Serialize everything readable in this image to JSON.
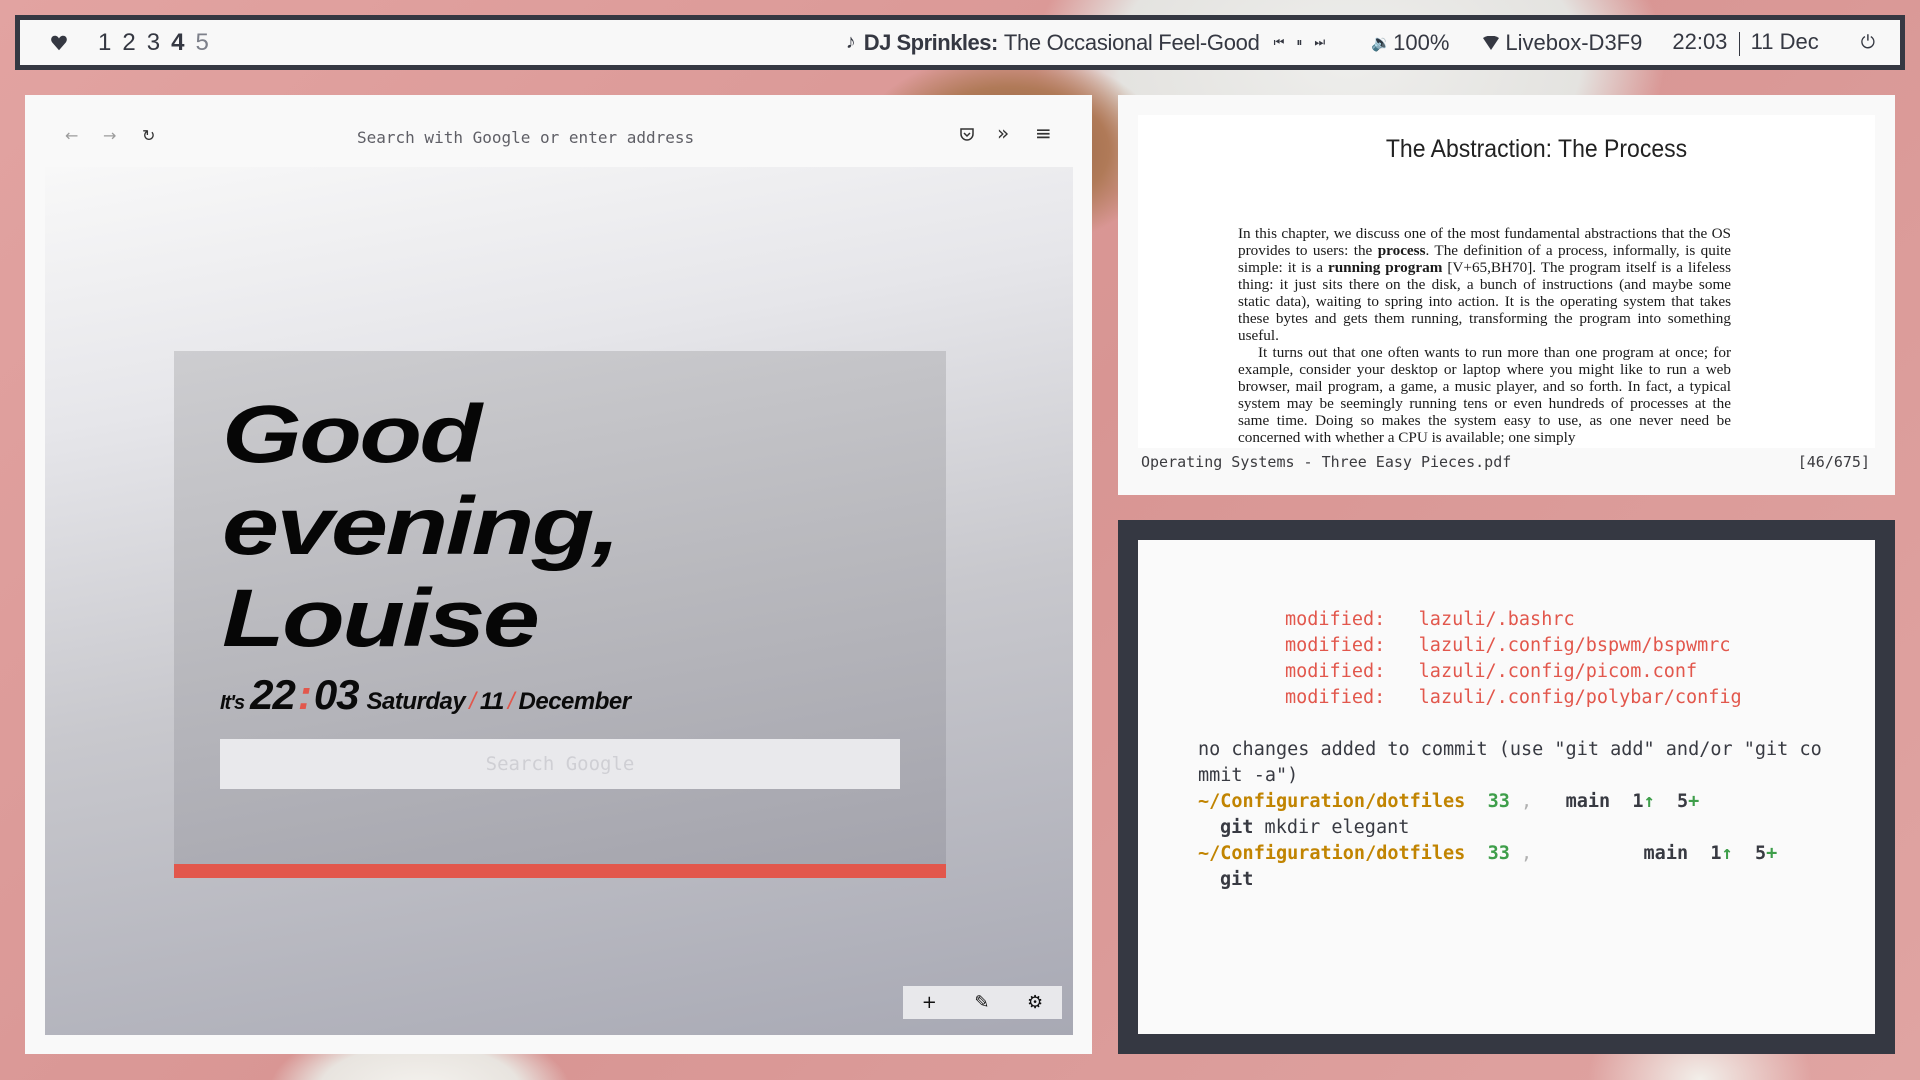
{
  "topbar": {
    "heart_icon": "heart-icon",
    "workspaces": [
      {
        "label": "1",
        "state": "normal"
      },
      {
        "label": "2",
        "state": "normal"
      },
      {
        "label": "3",
        "state": "normal"
      },
      {
        "label": "4",
        "state": "active"
      },
      {
        "label": "5",
        "state": "empty"
      }
    ],
    "music": {
      "icon": "music-note-icon",
      "artist": "DJ Sprinkles:",
      "track": "The Occasional Feel-Good",
      "controls": [
        "prev-icon",
        "pause-icon",
        "next-icon"
      ]
    },
    "volume": {
      "icon": "speaker-icon",
      "value": "100%"
    },
    "network": {
      "icon": "wifi-icon",
      "ssid": "Livebox-D3F9"
    },
    "clock": {
      "time": "22:03",
      "date": "11 Dec"
    },
    "power_icon": "power-icon"
  },
  "browser": {
    "toolbar": {
      "back_icon": "←",
      "forward_icon": "→",
      "reload_icon": "↻",
      "url_placeholder": "Search with Google or enter address",
      "pocket_icon": "pocket-icon",
      "overflow_icon": "»",
      "menu_icon": "≡"
    },
    "startpage": {
      "greeting_lines": [
        "Good",
        "evening,",
        "Louise"
      ],
      "its": "It's",
      "hour": "22",
      "colon": ":",
      "minute": "03",
      "weekday": "Saturday",
      "slash": "/",
      "day": "11",
      "month": "December",
      "search_placeholder": "Search Google",
      "accent_color": "#e2574c"
    },
    "dock": {
      "add": "+",
      "edit": "✎",
      "settings": "⚙"
    }
  },
  "pdf": {
    "title": "The Abstraction: The Process",
    "paragraph1": [
      {
        "t": "In this chapter, we discuss one of the most fundamental abstractions that the OS provides to users: the ",
        "b": false
      },
      {
        "t": "process",
        "b": true
      },
      {
        "t": ". The definition of a process, informally, is quite simple: it is a ",
        "b": false
      },
      {
        "t": "running program",
        "b": true
      },
      {
        "t": " [V+65,BH70]. The program itself is a lifeless thing: it just sits there on the disk, a bunch of instructions (and maybe some static data), waiting to spring into action. It is the operating system that takes these bytes and gets them running, transforming the program into something useful.",
        "b": false
      }
    ],
    "paragraph2": "It turns out that one often wants to run more than one program at once; for example, consider your desktop or laptop where you might like to run a web browser, mail program, a game, a music player, and so forth. In fact, a typical system may be seemingly running tens or even hundreds of processes at the same time. Doing so makes the system easy to use, as one never need be concerned with whether a CPU is available; one simply",
    "filename": "Operating Systems - Three Easy Pieces.pdf",
    "page_indicator": "[46/675]"
  },
  "terminal": {
    "modified": [
      {
        "label": "modified:",
        "path": "lazuli/.bashrc"
      },
      {
        "label": "modified:",
        "path": "lazuli/.config/bspwm/bspwmrc"
      },
      {
        "label": "modified:",
        "path": "lazuli/.config/picom.conf"
      },
      {
        "label": "modified:",
        "path": "lazuli/.config/polybar/config"
      }
    ],
    "hint_line1": "no changes added to commit (use \"git add\" and/or \"git co",
    "hint_line2": "mmit -a\")",
    "prompts": [
      {
        "path": "~/Configuration/dotfiles",
        "count": "33",
        "sep": ",",
        "branch": "main",
        "ahead": "1↑",
        "staged": "5+",
        "cmd_bold": "git",
        "cmd_rest": " mkdir elegant"
      },
      {
        "path": "~/Configuration/dotfiles",
        "count": "33",
        "sep": ",",
        "branch": "main",
        "ahead": "1↑",
        "staged": "5+",
        "cmd_bold": "git",
        "cmd_rest": ""
      }
    ]
  }
}
